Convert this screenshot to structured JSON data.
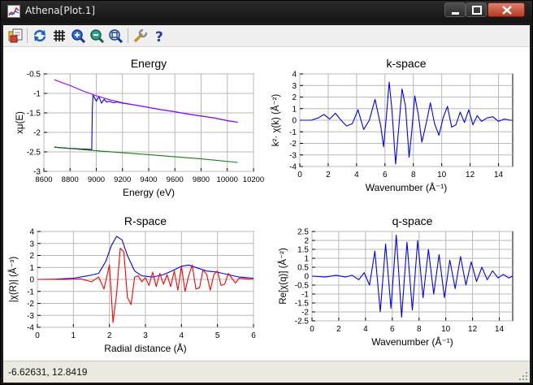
{
  "window": {
    "title": "Athena[Plot.1]",
    "controls": [
      "minimize",
      "maximize",
      "close"
    ]
  },
  "toolbar": {
    "buttons": [
      {
        "name": "open-icon"
      },
      {
        "name": "refresh-icon"
      },
      {
        "name": "grid-icon"
      },
      {
        "name": "zoom-in-icon"
      },
      {
        "name": "zoom-out-icon"
      },
      {
        "name": "zoom-fit-icon"
      },
      {
        "name": "settings-icon"
      },
      {
        "name": "help-icon"
      }
    ]
  },
  "status": {
    "coordinates": "-6.62631,  12.8419"
  },
  "chart_data": [
    {
      "type": "line",
      "title": "Energy",
      "xlabel": "Energy    (eV)",
      "ylabel": "xμ(E)",
      "xlim": [
        8600,
        10200
      ],
      "ylim": [
        -3,
        -0.5
      ],
      "xticks": [
        "8600",
        "8800",
        "9000",
        "9200",
        "9400",
        "9600",
        "9800",
        "10000",
        "10200"
      ],
      "yticks": [
        "-0.5",
        "-1",
        "-1.5",
        "-2",
        "-2.5",
        "-3"
      ],
      "grid": true,
      "series": [
        {
          "color": "#0000ff",
          "x": [
            8680,
            8900,
            8965,
            8970,
            8975,
            8985,
            9000,
            9020,
            9040,
            9060,
            9080,
            9100,
            9130,
            9160,
            9200,
            9300,
            9400,
            9500,
            9600,
            9700,
            9800,
            9900,
            10000,
            10080
          ],
          "y": [
            -2.38,
            -2.44,
            -2.45,
            -1.35,
            -1.05,
            -1.1,
            -1.2,
            -1.08,
            -1.25,
            -1.15,
            -1.22,
            -1.2,
            -1.24,
            -1.22,
            -1.25,
            -1.3,
            -1.36,
            -1.42,
            -1.47,
            -1.53,
            -1.58,
            -1.63,
            -1.7,
            -1.74
          ]
        },
        {
          "color": "#9b00ff",
          "x": [
            8680,
            8800,
            8900,
            9000,
            9100,
            9200,
            9300,
            9400,
            9500,
            9600,
            9700,
            9800,
            9900,
            10000,
            10080
          ],
          "y": [
            -0.65,
            -0.8,
            -0.94,
            -1.06,
            -1.16,
            -1.24,
            -1.3,
            -1.36,
            -1.42,
            -1.47,
            -1.53,
            -1.58,
            -1.63,
            -1.7,
            -1.74
          ]
        },
        {
          "color": "#000000",
          "x": [
            8680,
            8800,
            8960
          ],
          "y": [
            -2.38,
            -2.41,
            -2.44
          ]
        },
        {
          "color": "#1a7a1a",
          "x": [
            8680,
            9000,
            9400,
            9800,
            10080
          ],
          "y": [
            -2.38,
            -2.47,
            -2.57,
            -2.68,
            -2.77
          ]
        }
      ]
    },
    {
      "type": "line",
      "title": "k-space",
      "xlabel": "Wavenumber    (Å⁻¹)",
      "ylabel": "k²· χ(k)    (Å⁻²)",
      "xlim": [
        0,
        15
      ],
      "ylim": [
        -4,
        4
      ],
      "xticks": [
        "0",
        "2",
        "4",
        "6",
        "8",
        "10",
        "12",
        "14"
      ],
      "yticks": [
        "4",
        "3",
        "2",
        "1",
        "0",
        "-1",
        "-2",
        "-3",
        "-4"
      ],
      "grid": true,
      "series": [
        {
          "color": "#0000ff",
          "x": [
            0,
            0.8,
            1.3,
            1.7,
            2.1,
            2.5,
            2.9,
            3.3,
            3.7,
            4.1,
            4.5,
            4.9,
            5.3,
            5.7,
            5.9,
            6.1,
            6.3,
            6.5,
            6.75,
            7.0,
            7.2,
            7.45,
            7.7,
            7.9,
            8.1,
            8.35,
            8.6,
            8.9,
            9.2,
            9.5,
            9.8,
            10.1,
            10.4,
            10.7,
            11.0,
            11.3,
            11.6,
            11.9,
            12.2,
            12.5,
            12.8,
            13.2,
            13.6,
            14.0,
            14.4,
            14.8,
            15.0
          ],
          "y": [
            0,
            0,
            0.2,
            0.5,
            0.1,
            0.6,
            0.0,
            -0.5,
            -0.3,
            0.9,
            -0.8,
            0.0,
            1.8,
            -0.5,
            -2.3,
            0.3,
            3.3,
            0.8,
            -3.8,
            -0.2,
            2.7,
            1.2,
            -3.2,
            -0.8,
            2.1,
            0.5,
            -1.9,
            -0.3,
            1.5,
            -0.3,
            -1.3,
            0.2,
            1.2,
            -0.6,
            -0.4,
            0.7,
            -0.2,
            0.9,
            -0.4,
            0.4,
            -0.1,
            0.2,
            0.3,
            -0.1,
            0.1,
            0.0,
            0.0
          ]
        }
      ]
    },
    {
      "type": "line",
      "title": "R-space",
      "xlabel": "Radial distance    (Å)",
      "ylabel": "|χ(R)|    (Å⁻³)",
      "xlim": [
        0,
        6
      ],
      "ylim": [
        -4,
        4
      ],
      "xticks": [
        "0",
        "1",
        "2",
        "3",
        "4",
        "5",
        "6"
      ],
      "yticks": [
        "4",
        "3",
        "2",
        "1",
        "0",
        "-1",
        "-2",
        "-3",
        "-4"
      ],
      "grid": true,
      "series": [
        {
          "color": "#0000ff",
          "x": [
            0,
            0.5,
            1.0,
            1.4,
            1.7,
            1.9,
            2.05,
            2.2,
            2.35,
            2.5,
            2.7,
            2.9,
            3.2,
            3.5,
            3.8,
            4.0,
            4.2,
            4.4,
            4.7,
            5.0,
            5.3,
            5.6,
            6.0
          ],
          "y": [
            0,
            0.02,
            0.1,
            0.3,
            0.5,
            1.5,
            2.8,
            3.6,
            3.3,
            2.0,
            0.7,
            0.3,
            0.2,
            0.4,
            0.8,
            1.1,
            1.2,
            1.0,
            0.7,
            0.6,
            0.4,
            0.2,
            0.1
          ]
        },
        {
          "color": "#ff0000",
          "x": [
            0,
            0.8,
            1.2,
            1.5,
            1.7,
            1.85,
            2.0,
            2.1,
            2.2,
            2.3,
            2.4,
            2.5,
            2.6,
            2.7,
            2.8,
            2.9,
            3.0,
            3.1,
            3.2,
            3.3,
            3.4,
            3.5,
            3.6,
            3.7,
            3.8,
            3.9,
            4.0,
            4.1,
            4.2,
            4.3,
            4.4,
            4.5,
            4.6,
            4.7,
            4.8,
            4.9,
            5.0,
            5.1,
            5.2,
            5.3,
            5.4,
            5.5,
            5.6,
            5.8,
            6.0
          ],
          "y": [
            0,
            0,
            0.05,
            -0.2,
            0.2,
            -0.8,
            1.2,
            -3.6,
            -1.2,
            2.6,
            2.3,
            -1.5,
            -2.1,
            0.2,
            0.3,
            -0.2,
            0.15,
            -0.5,
            0.6,
            -0.6,
            0.5,
            -0.4,
            0.4,
            -0.6,
            0.7,
            -0.9,
            1.1,
            -1.0,
            0.3,
            1.2,
            -0.8,
            -0.7,
            0.8,
            0.4,
            -0.9,
            0.4,
            0.7,
            -0.5,
            -0.4,
            0.5,
            0.1,
            -0.3,
            0.1,
            0.05,
            0.0
          ]
        }
      ]
    },
    {
      "type": "line",
      "title": "q-space",
      "xlabel": "Wavenumber    (Å⁻¹)",
      "ylabel": "Re[χ(q)]    (Å⁻²)",
      "xlim": [
        0,
        15
      ],
      "ylim": [
        -2.5,
        2.5
      ],
      "xticks": [
        "0",
        "2",
        "4",
        "6",
        "8",
        "10",
        "12",
        "14"
      ],
      "yticks": [
        "2.5",
        "2",
        "1.5",
        "1",
        "0.5",
        "0",
        "-0.5",
        "-1",
        "-1.5",
        "-2",
        "-2.5"
      ],
      "grid": true,
      "series": [
        {
          "color": "#0000ff",
          "x": [
            0,
            1.0,
            1.8,
            2.5,
            3.0,
            3.5,
            3.9,
            4.3,
            4.7,
            5.1,
            5.5,
            5.9,
            6.3,
            6.7,
            7.1,
            7.5,
            7.9,
            8.3,
            8.7,
            9.1,
            9.5,
            9.9,
            10.3,
            10.7,
            11.1,
            11.5,
            11.9,
            12.3,
            12.7,
            13.1,
            13.5,
            13.9,
            14.3,
            14.7,
            15.0
          ],
          "y": [
            0,
            -0.05,
            0.05,
            -0.05,
            0.05,
            -0.2,
            0.2,
            -0.5,
            1.4,
            -2.0,
            1.8,
            -1.8,
            2.3,
            -2.3,
            1.9,
            -1.9,
            2.0,
            -1.2,
            1.5,
            -1.0,
            1.2,
            -1.2,
            0.9,
            -0.7,
            1.1,
            -0.5,
            0.8,
            -0.3,
            0.5,
            -0.2,
            0.3,
            -0.1,
            0.1,
            -0.1,
            0.0
          ]
        }
      ]
    }
  ]
}
